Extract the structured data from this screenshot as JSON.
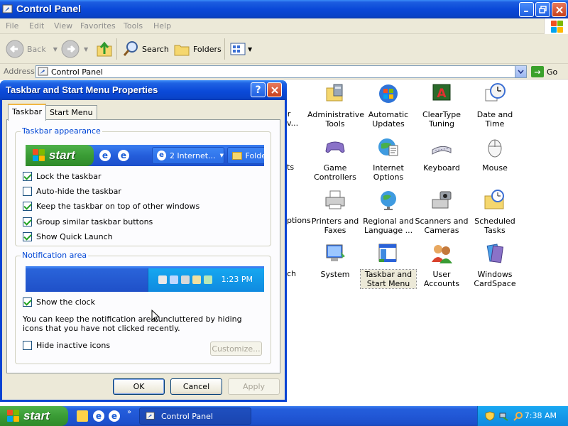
{
  "window": {
    "title": "Control Panel",
    "menu": [
      "File",
      "Edit",
      "View",
      "Favorites",
      "Tools",
      "Help"
    ],
    "toolbar": {
      "back": "Back",
      "search": "Search",
      "folders": "Folders"
    },
    "address": {
      "label": "Address",
      "value": "Control Panel",
      "go": "Go"
    }
  },
  "control_panel_items": [
    {
      "label": "Administrative Tools",
      "icon": "administrative-tools-icon"
    },
    {
      "label": "Automatic Updates",
      "icon": "automatic-updates-icon"
    },
    {
      "label": "ClearType Tuning",
      "icon": "cleartype-icon"
    },
    {
      "label": "Date and Time",
      "icon": "date-time-icon"
    },
    {
      "label": "Game Controllers",
      "icon": "game-controllers-icon"
    },
    {
      "label": "Internet Options",
      "icon": "internet-options-icon"
    },
    {
      "label": "Keyboard",
      "icon": "keyboard-icon"
    },
    {
      "label": "Mouse",
      "icon": "mouse-icon"
    },
    {
      "label": "Printers and Faxes",
      "icon": "printers-icon"
    },
    {
      "label": "Regional and Language ...",
      "icon": "regional-icon"
    },
    {
      "label": "Scanners and Cameras",
      "icon": "scanners-icon"
    },
    {
      "label": "Scheduled Tasks",
      "icon": "scheduled-tasks-icon"
    },
    {
      "label": "System",
      "icon": "system-icon"
    },
    {
      "label": "Taskbar and Start Menu",
      "icon": "taskbar-start-menu-icon",
      "selected": true
    },
    {
      "label": "User Accounts",
      "icon": "user-accounts-icon"
    },
    {
      "label": "Windows CardSpace",
      "icon": "cardspace-icon"
    }
  ],
  "partial_labels": [
    "or",
    "v...",
    "ts",
    "ptions",
    "ch"
  ],
  "dialog": {
    "title": "Taskbar and Start Menu Properties",
    "tabs": [
      "Taskbar",
      "Start Menu"
    ],
    "appearance": {
      "group_label": "Taskbar appearance",
      "preview_start": "start",
      "preview_task1": "2 Internet...",
      "preview_task2": "Folde",
      "options": [
        {
          "label": "Lock the taskbar",
          "checked": true
        },
        {
          "label": "Auto-hide the taskbar",
          "checked": false
        },
        {
          "label": "Keep the taskbar on top of other windows",
          "checked": true
        },
        {
          "label": "Group similar taskbar buttons",
          "checked": true
        },
        {
          "label": "Show Quick Launch",
          "checked": true
        }
      ]
    },
    "notification": {
      "group_label": "Notification area",
      "preview_clock": "1:23 PM",
      "show_clock": {
        "label": "Show the clock",
        "checked": true
      },
      "description": "You can keep the notification area uncluttered by hiding icons that you have not clicked recently.",
      "hide_inactive": {
        "label": "Hide inactive icons",
        "checked": false
      },
      "customize": "Customize..."
    },
    "buttons": {
      "ok": "OK",
      "cancel": "Cancel",
      "apply": "Apply"
    }
  },
  "taskbar": {
    "start": "start",
    "task": "Control Panel",
    "clock": "7:38 AM"
  }
}
